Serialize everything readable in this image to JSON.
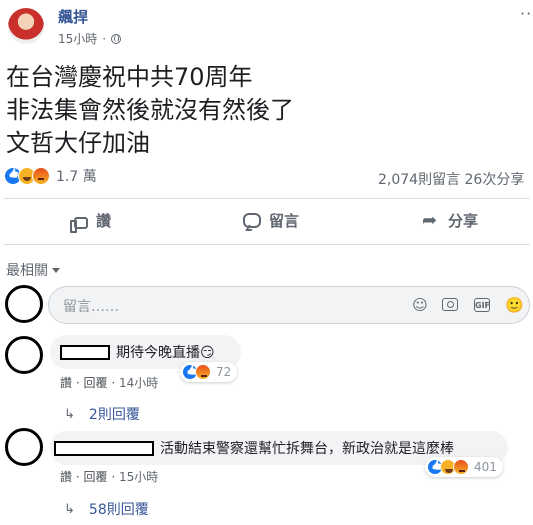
{
  "post": {
    "author": "飆捍",
    "time": "15小時",
    "separator": "·",
    "lines": [
      "在台灣慶祝中共70周年",
      "非法集會然後就沒有然後了",
      "文哲大仔加油"
    ],
    "more_icon": "···"
  },
  "summary": {
    "reactions": [
      "like",
      "haha",
      "angry"
    ],
    "count": "1.7 萬",
    "stats": "2,074則留言  26次分享"
  },
  "actions": [
    {
      "label": "讚",
      "icon": "thumbs-up-icon"
    },
    {
      "label": "留言",
      "icon": "comment-icon"
    },
    {
      "label": "分享",
      "icon": "share-icon"
    }
  ],
  "sort": {
    "label": "最相關"
  },
  "composer": {
    "placeholder": "留言……"
  },
  "comments": [
    {
      "text": "期待今晚直播😏",
      "like_label": "讚",
      "sep": "·",
      "reply_label": "回覆",
      "time": "14小時",
      "reactions": [
        "like",
        "angry"
      ],
      "reaction_count": "72",
      "replies_label": "2則回覆"
    },
    {
      "text": "活動結束警察還幫忙拆舞台，新政治就是這麼棒",
      "like_label": "讚",
      "sep": "·",
      "reply_label": "回覆",
      "time": "15小時",
      "reactions": [
        "like",
        "haha",
        "angry"
      ],
      "reaction_count": "401",
      "replies_label": "58則回覆"
    }
  ],
  "colors": {
    "link": "#385898",
    "muted": "#606770",
    "bubble": "#f2f3f5",
    "like": "#1877f2"
  }
}
